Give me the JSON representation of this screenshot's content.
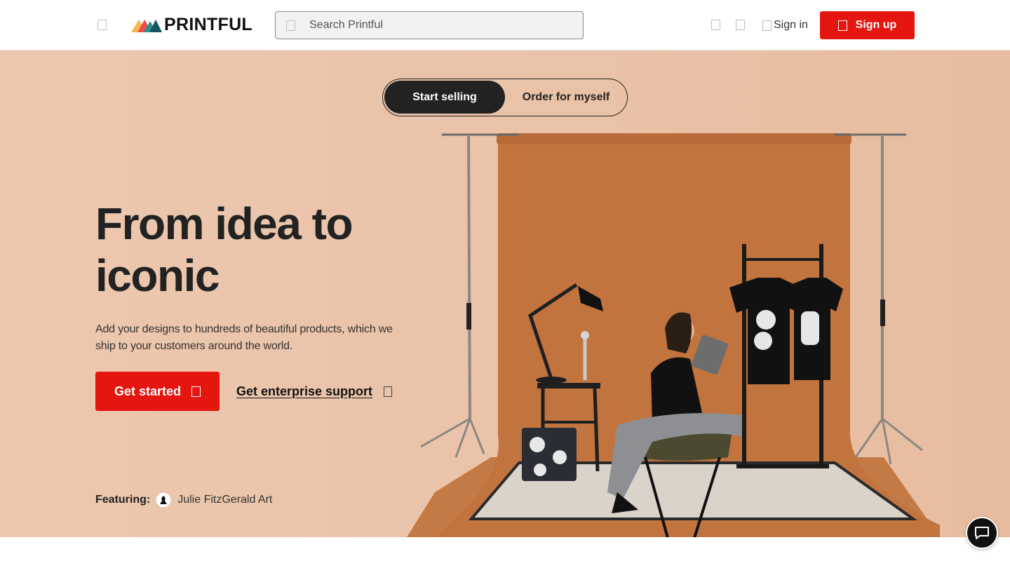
{
  "header": {
    "logo_text": "PRINTFUL",
    "search_placeholder": "Search Printful",
    "signin_label": "Sign in",
    "signup_label": "Sign up",
    "icons": [
      "menu-icon",
      "search-icon",
      "globe-icon",
      "cart-icon",
      "user-icon",
      "user-plus-icon"
    ]
  },
  "hero": {
    "toggle": {
      "active_label": "Start selling",
      "inactive_label": "Order for myself"
    },
    "headline_line1": "From idea to",
    "headline_line2": "iconic",
    "subtext": "Add your designs to hundreds of beautiful products, which we ship to your customers around the world.",
    "cta_label": "Get started",
    "enterprise_label": "Get enterprise support",
    "featuring_label": "Featuring:",
    "featuring_name": "Julie FitzGerald Art"
  },
  "colors": {
    "brand_red": "#e5150f",
    "hero_bg": "#eac3a9",
    "backdrop": "#c67a47",
    "dark": "#222222"
  }
}
